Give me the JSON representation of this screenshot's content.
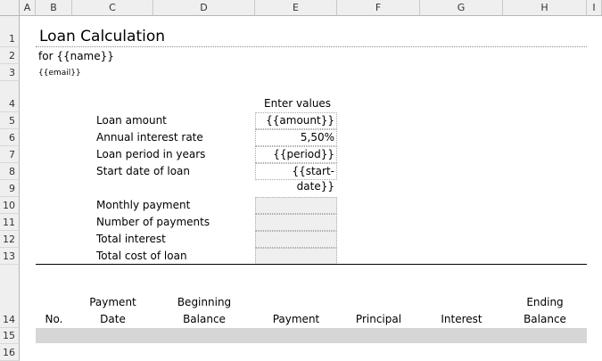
{
  "columns": [
    "A",
    "B",
    "C",
    "D",
    "E",
    "F",
    "G",
    "H",
    "I"
  ],
  "rows": [
    "1",
    "2",
    "3",
    "4",
    "5",
    "6",
    "7",
    "8",
    "9",
    "10",
    "11",
    "12",
    "13",
    "14",
    "15",
    "16"
  ],
  "sheet": {
    "title": "Loan Calculation",
    "for_line": "for {{name}}",
    "email": "{{email}}",
    "enter_values_label": "Enter values",
    "inputs": [
      {
        "label": "Loan amount",
        "value": "{{amount}}"
      },
      {
        "label": "Annual interest rate",
        "value": "5,50%"
      },
      {
        "label": "Loan period in years",
        "value": "{{period}}"
      },
      {
        "label": "Start date of loan",
        "value": "{{start-date}}"
      }
    ],
    "outputs": [
      {
        "label": "Monthly payment",
        "value": ""
      },
      {
        "label": "Number of payments",
        "value": ""
      },
      {
        "label": "Total interest",
        "value": ""
      },
      {
        "label": "Total cost of loan",
        "value": ""
      }
    ],
    "table_headers": {
      "no": "No.",
      "payment_date_top": "Payment",
      "payment_date_bottom": "Date",
      "beginning_balance_top": "Beginning",
      "beginning_balance_bottom": "Balance",
      "payment": "Payment",
      "principal": "Principal",
      "interest": "Interest",
      "ending_balance_top": "Ending",
      "ending_balance_bottom": "Balance"
    }
  }
}
